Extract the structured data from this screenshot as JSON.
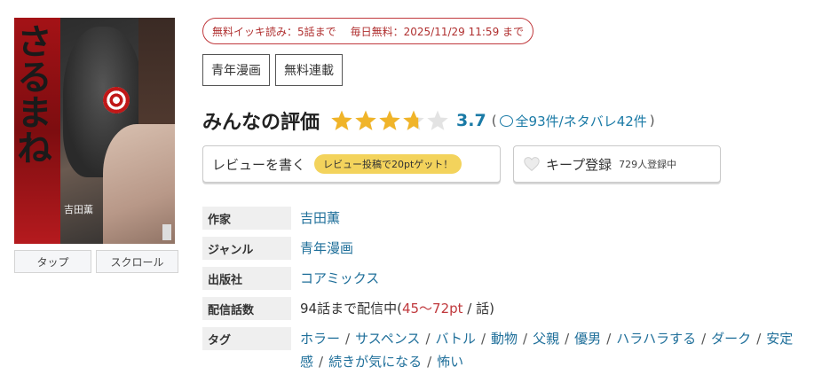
{
  "cover": {
    "title_art": "さるまね",
    "author_on_cover": "吉田薫",
    "buttons": [
      "タップ",
      "スクロール"
    ]
  },
  "free_banner": {
    "part1": "無料イッキ読み：5話まで",
    "part2": "毎日無料：2025/11/29 11:59 まで"
  },
  "genre_tags": [
    "青年漫画",
    "無料連載"
  ],
  "rating": {
    "title": "みんなの評価",
    "stars_value": 3.7,
    "score": "3.7",
    "paren_open": "(",
    "total": "全93件/ネタバレ42件",
    "paren_close": ")",
    "star_color": "#f0b429"
  },
  "actions": {
    "review_label": "レビューを書く",
    "review_promo": "レビュー投稿で20ptゲット！",
    "keep_label": "キープ登録",
    "keep_count": "729人登録中"
  },
  "info": {
    "author_label": "作家",
    "author": "吉田薫",
    "genre_label": "ジャンル",
    "genre": "青年漫画",
    "publisher_label": "出版社",
    "publisher": "コアミックス",
    "episodes_label": "配信話数",
    "episodes_prefix": "94話まで配信中(",
    "episodes_price": "45〜72pt",
    "episodes_suffix": " / 話)",
    "tags_label": "タグ",
    "tags": [
      "ホラー",
      "サスペンス",
      "バトル",
      "動物",
      "父親",
      "優男",
      "ハラハラする",
      "ダーク",
      "安定感",
      "続きが気になる",
      "怖い"
    ]
  },
  "colors": {
    "link": "#1f6f9a",
    "accent_red": "#c0393d",
    "promo_yellow": "#f3d35c"
  }
}
